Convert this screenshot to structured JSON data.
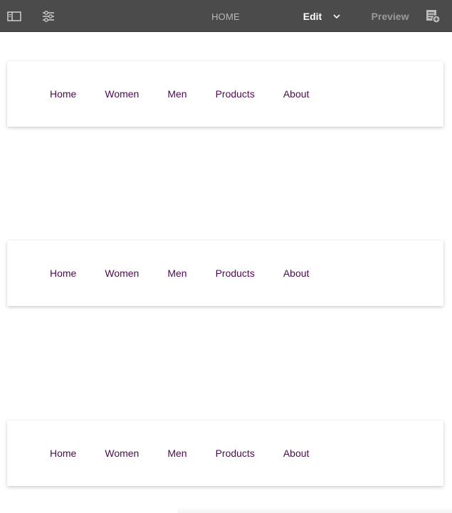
{
  "toolbar": {
    "page_title": "HOME",
    "edit_label": "Edit",
    "preview_label": "Preview",
    "icons": [
      "side-panel-icon",
      "properties-sliders-icon",
      "chevron-down-icon",
      "annotations-icon"
    ],
    "background_color": "#4b4b4b"
  },
  "nav_components": [
    {
      "items": [
        "Home",
        "Women",
        "Men",
        "Products",
        "About"
      ]
    },
    {
      "items": [
        "Home",
        "Women",
        "Men",
        "Products",
        "About"
      ]
    },
    {
      "items": [
        "Home",
        "Women",
        "Men",
        "Products",
        "About"
      ]
    }
  ],
  "colors": {
    "nav_link": "#4b0a4e",
    "edit_active": "#ffffff",
    "preview_inactive": "#9a9a9a"
  }
}
